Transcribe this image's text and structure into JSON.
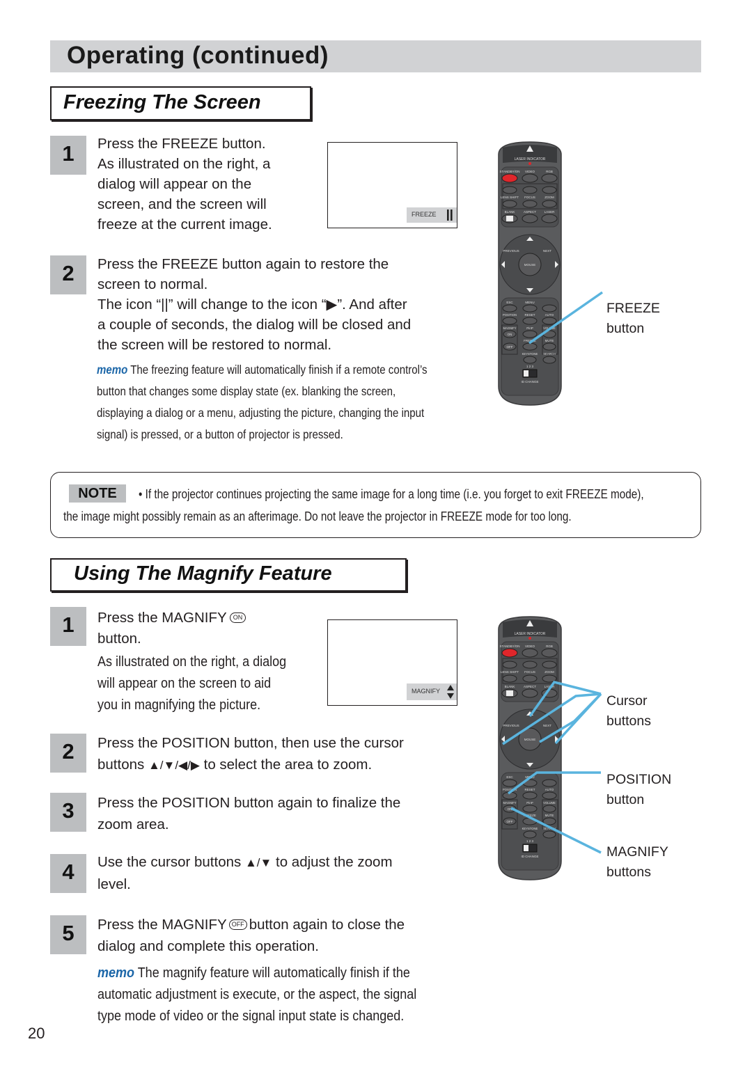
{
  "page": {
    "title": "Operating (continued)",
    "page_number": "20"
  },
  "freeze": {
    "heading": "Freezing The Screen",
    "steps": [
      {
        "num": "1",
        "lines": [
          "Press the FREEZE button.",
          "As illustrated on the right, a",
          "dialog will appear on the",
          "screen, and the screen will",
          "freeze at the current image."
        ]
      },
      {
        "num": "2",
        "lines": [
          "Press the FREEZE button again to restore the",
          "screen to normal.",
          "The icon “||” will change to the icon “▶”.  And after",
          "a couple of seconds, the dialog will be closed and",
          "the screen will be restored to normal."
        ]
      }
    ],
    "memo_label": "memo",
    "memo_lines": [
      " The freezing feature will automatically finish if a remote control’s",
      "button that changes some display state (ex. blanking the screen,",
      "displaying a dialog or a menu, adjusting the picture, changing the input",
      "signal) is pressed, or a button of projector is pressed."
    ],
    "osd_label": "FREEZE",
    "osd_icon": "pause-icon",
    "callout": {
      "line1": "FREEZE",
      "line2": "button"
    }
  },
  "note": {
    "badge": "NOTE",
    "line1": "•  If the projector continues projecting the same image for a long time (i.e. you forget to exit FREEZE mode),",
    "line2": "the image might possibly remain as an afterimage. Do not leave the projector in FREEZE mode for too long."
  },
  "magnify": {
    "heading": "Using The Magnify Feature",
    "step1": {
      "num": "1",
      "line1_a": "Press the MAGNIFY",
      "on_badge": "ON",
      "line2": "button.",
      "sub_lines": [
        "As illustrated on the right, a dialog",
        "will appear on the screen to aid",
        "you in magnifying the picture."
      ]
    },
    "step2": {
      "num": "2",
      "line1": "Press the POSITION button, then use the cursor",
      "line2_a": "buttons ",
      "arrows": "▲/▼/◀/▶",
      "line2_b": " to select the area to zoom."
    },
    "step3": {
      "num": "3",
      "line1": "Press the POSITION button again to finalize the",
      "line2": "zoom area."
    },
    "step4": {
      "num": "4",
      "line1_a": "Use the cursor buttons ",
      "arrows": "▲/▼",
      "line1_b": " to adjust the zoom",
      "line2": "level."
    },
    "step5": {
      "num": "5",
      "line1_a": "Press the MAGNIFY",
      "off_badge": "OFF",
      "line1_b": "button again to close the",
      "line2": "dialog and complete this operation."
    },
    "memo_label": "memo",
    "memo_lines": [
      " The magnify feature will automatically finish if the",
      "automatic adjustment is execute, or the aspect, the signal",
      "type mode of video or the signal input state is changed."
    ],
    "osd_label": "MAGNIFY",
    "callouts": {
      "cursor": {
        "line1": "Cursor",
        "line2": "buttons"
      },
      "position": {
        "line1": "POSITION",
        "line2": "button"
      },
      "magnify": {
        "line1": "MAGNIFY",
        "line2": "buttons"
      }
    }
  },
  "remote": {
    "laser_indicator": "LASER INDICATOR",
    "row1": [
      "STANDBY/ON",
      "VIDEO",
      "RGB"
    ],
    "row2": [
      "LENS SHIFT",
      "FOCUS",
      "ZOOM"
    ],
    "row3": [
      "BLANK",
      "ASPECT",
      "LASER"
    ],
    "nav": {
      "previous": "PREVIOUS",
      "next": "NEXT",
      "mouse": "MOUSE"
    },
    "row4": [
      "ESC",
      "MENU",
      ""
    ],
    "row5": [
      "POSITION",
      "RESET",
      "AUTO"
    ],
    "row6": [
      "MAGNIFY",
      "PinP",
      "VOLUME"
    ],
    "magnify_on": "ON",
    "magnify_off": "OFF",
    "row7": [
      "FREEZE",
      "MUTE"
    ],
    "row8": [
      "KEYSTONE",
      "SEARCH"
    ],
    "id_numbers": "1  2  3",
    "id_change": "ID CHANGE"
  },
  "colors": {
    "callout_line": "#5ab4de",
    "memo": "#1b66a8",
    "step_box": "#bcbec0",
    "title_band": "#d1d2d4",
    "remote_body": "#5a5b5d",
    "standby_red": "#e0262b"
  }
}
